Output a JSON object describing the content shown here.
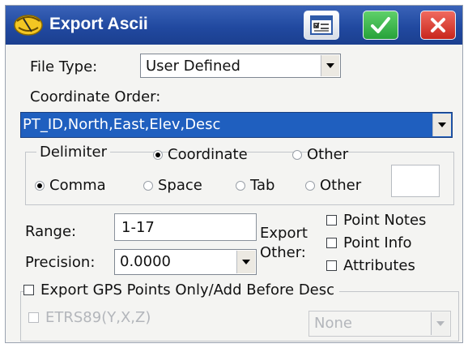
{
  "window": {
    "title": "Export Ascii"
  },
  "titlebar_buttons": {
    "options_icon": "list-dialog-icon",
    "ok_icon": "checkmark-icon",
    "close_icon": "x-icon"
  },
  "file_type": {
    "label": "File Type:",
    "value": "User Defined"
  },
  "coordinate_order": {
    "label": "Coordinate Order:",
    "value": "PT_ID,North,East,Elev,Desc"
  },
  "delimiter": {
    "group_label": "Delimiter",
    "scope_options": [
      {
        "label": "Coordinate",
        "selected": true
      },
      {
        "label": "Other",
        "selected": false
      }
    ],
    "char_options": [
      {
        "label": "Comma",
        "selected": true
      },
      {
        "label": "Space",
        "selected": false
      },
      {
        "label": "Tab",
        "selected": false
      },
      {
        "label": "Other",
        "selected": false
      }
    ],
    "other_value": ""
  },
  "range": {
    "label": "Range:",
    "value": "1-17"
  },
  "precision": {
    "label": "Precision:",
    "value": "0.0000"
  },
  "export_other": {
    "label_line1": "Export",
    "label_line2": "Other:",
    "options": [
      {
        "label": "Point Notes",
        "checked": false
      },
      {
        "label": "Point Info",
        "checked": false
      },
      {
        "label": "Attributes",
        "checked": false
      }
    ]
  },
  "gps": {
    "export_gps_label": "Export GPS Points Only/Add Before Desc",
    "export_gps_checked": false,
    "etrs_label": "ETRS89(Y,X,Z)",
    "etrs_checked": false,
    "etrs_combo_value": "None"
  },
  "colors": {
    "titlebar": "#2149a0",
    "selection": "#1f5fbf",
    "ok_green": "#27a23a",
    "close_red": "#c8261c"
  }
}
